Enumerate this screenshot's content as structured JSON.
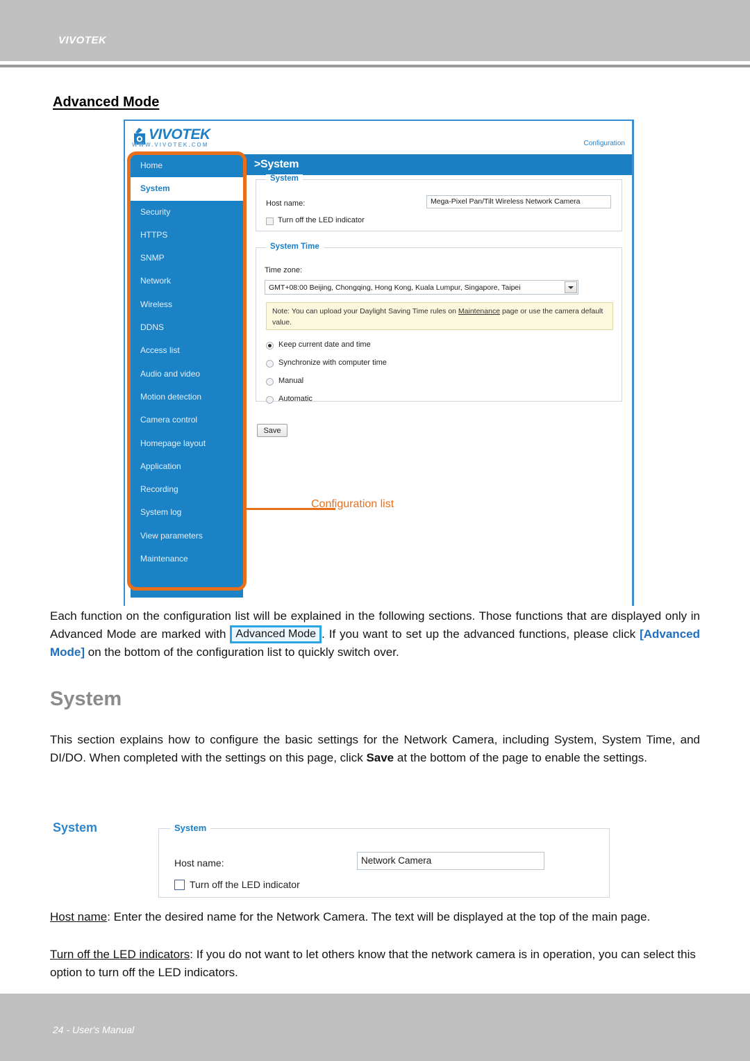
{
  "header": {
    "brand": "VIVOTEK"
  },
  "footer": {
    "page_label": "24 - User's Manual"
  },
  "section": {
    "heading": "Advanced Mode"
  },
  "screenshot": {
    "logo_text": "VIVOTEK",
    "logo_url": "WWW.VIVOTEK.COM",
    "config_label": "Configuration",
    "page_title": ">System",
    "sidebar_items": [
      {
        "label": "Home",
        "selected": false
      },
      {
        "label": "System",
        "selected": true
      },
      {
        "label": "Security",
        "selected": false
      },
      {
        "label": "HTTPS",
        "selected": false
      },
      {
        "label": "SNMP",
        "selected": false
      },
      {
        "label": "Network",
        "selected": false
      },
      {
        "label": "Wireless",
        "selected": false
      },
      {
        "label": "DDNS",
        "selected": false
      },
      {
        "label": "Access list",
        "selected": false
      },
      {
        "label": "Audio and video",
        "selected": false
      },
      {
        "label": "Motion detection",
        "selected": false
      },
      {
        "label": "Camera control",
        "selected": false
      },
      {
        "label": "Homepage layout",
        "selected": false
      },
      {
        "label": "Application",
        "selected": false
      },
      {
        "label": "Recording",
        "selected": false
      },
      {
        "label": "System log",
        "selected": false
      },
      {
        "label": "View parameters",
        "selected": false
      },
      {
        "label": "Maintenance",
        "selected": false
      }
    ],
    "callout": {
      "label": "Configuration list",
      "color": "#e8701a"
    },
    "system_panel": {
      "legend": "System",
      "host_name_label": "Host name:",
      "host_name_value": "Mega-Pixel Pan/Tilt Wireless Network Camera",
      "led_checkbox_label": "Turn off the LED indicator",
      "led_checked": false
    },
    "system_time_panel": {
      "legend": "System Time",
      "time_zone_label": "Time zone:",
      "time_zone_value": "GMT+08:00 Beijing, Chongqing, Hong Kong, Kuala Lumpur, Singapore, Taipei",
      "note_prefix": "Note: You can upload your Daylight Saving Time rules on ",
      "note_link": "Maintenance",
      "note_suffix": " page or use the camera default value.",
      "options": [
        {
          "label": "Keep current date and time",
          "selected": true
        },
        {
          "label": "Synchronize with computer time",
          "selected": false
        },
        {
          "label": "Manual",
          "selected": false
        },
        {
          "label": "Automatic",
          "selected": false
        }
      ],
      "save_label": "Save"
    }
  },
  "body": {
    "intro_part1": "Each function on the configuration list will be explained in the following sections. Those functions that are displayed only in Advanced Mode are marked with ",
    "intro_badge": "Advanced Mode",
    "intro_part2": ". If you want to set up the advanced functions, please click ",
    "intro_link": "[Advanced Mode]",
    "intro_part3": " on the bottom of the configuration list to quickly switch over.",
    "system_heading": "System",
    "system_part1": "This section explains how to configure the basic settings for the Network Camera, including System, System Time, and DI/DO. When completed with the settings on this page, click ",
    "system_bold": "Save",
    "system_part2": " at the bottom of the page to enable the settings.",
    "sub_system_label": "System",
    "hostname_term": "Host name",
    "hostname_desc": ": Enter the desired name for the Network Camera. The text will be displayed at the top of the main page.",
    "led_term": "Turn off the LED indicators",
    "led_desc": ": If you do not want to let others know that the network camera is in operation, you can select this option to turn off the LED indicators."
  },
  "system_panel2": {
    "legend": "System",
    "host_name_label": "Host name:",
    "host_name_value": "Network Camera",
    "led_checkbox_label": "Turn off the LED indicator",
    "led_checked": false
  }
}
